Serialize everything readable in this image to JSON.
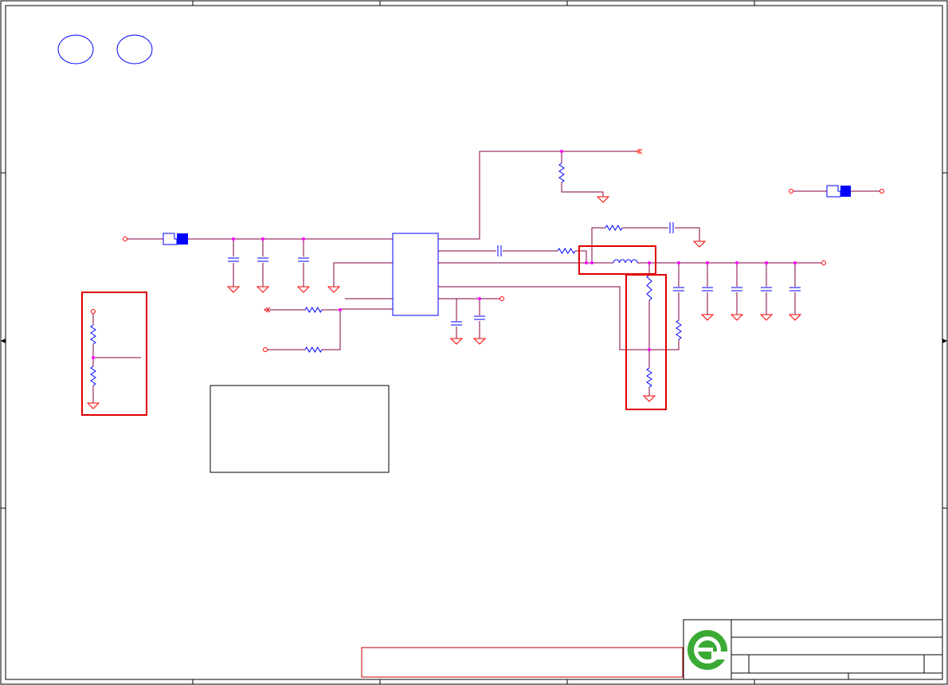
{
  "sheet": {
    "page_size": "A4 landscape",
    "colors": {
      "frame": "#000000",
      "wire": "#800040",
      "component": "#0000ff",
      "junction": "#ff00ff",
      "ground": "#ff0000",
      "port": "#ff0000",
      "highlight": "#e00000",
      "footer_box": "#c00000",
      "logo": "#3aaa35",
      "fill": "#0000ff"
    }
  },
  "symbols": {
    "ground_count": 16,
    "capacitor_count": 12,
    "resistor_count": 9,
    "inductor_count": 1,
    "ic_count": 1,
    "connector_port_count": 2,
    "sheet_connector_count": 2,
    "highlighted_regions": 3
  },
  "labels": {
    "title_block_text": "",
    "note_box_text": "",
    "footer_text": ""
  },
  "logo": {
    "icon": "e-circle-logo-icon"
  }
}
